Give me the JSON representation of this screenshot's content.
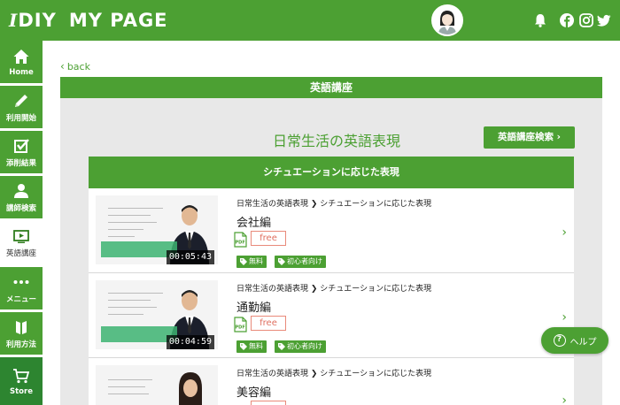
{
  "header": {
    "logo_mark": "I",
    "logo_text": "DIY",
    "logo_page": "MY PAGE",
    "icons": [
      "avatar",
      "bell-icon",
      "facebook-icon",
      "instagram-icon",
      "twitter-icon"
    ]
  },
  "sidebar": {
    "items": [
      {
        "label": "Home",
        "icon": "home-icon"
      },
      {
        "label": "利用開始",
        "icon": "pencil-icon"
      },
      {
        "label": "添削結果",
        "icon": "checkbox-icon"
      },
      {
        "label": "講師検索",
        "icon": "person-icon"
      },
      {
        "label": "英語講座",
        "icon": "video-icon"
      },
      {
        "label": "メニュー",
        "icon": "dots-icon"
      },
      {
        "label": "利用方法",
        "icon": "book-icon"
      },
      {
        "label": "Store",
        "icon": "cart-icon"
      }
    ]
  },
  "main": {
    "back_label": "back",
    "panel_title": "英語講座",
    "course_title": "日常生活の英語表現",
    "search_button": "英語講座検索",
    "section_title": "シチュエーションに応じた表現"
  },
  "lessons": [
    {
      "crumb_parent": "日常生活の英語表現",
      "crumb_child": "シチュエーションに応じた表現",
      "title": "会社編",
      "badge": "free",
      "duration": "00:05:43",
      "tags": [
        "無料",
        "初心者向け"
      ]
    },
    {
      "crumb_parent": "日常生活の英語表現",
      "crumb_child": "シチュエーションに応じた表現",
      "title": "通勤編",
      "badge": "free",
      "duration": "00:04:59",
      "tags": [
        "無料",
        "初心者向け"
      ]
    },
    {
      "crumb_parent": "日常生活の英語表現",
      "crumb_child": "シチュエーションに応じた表現",
      "title": "美容編",
      "badge": "free",
      "duration": "",
      "tags": []
    }
  ],
  "help": {
    "label": "ヘルプ"
  },
  "colors": {
    "brand_green": "#4ca033",
    "store_green": "#2d8530",
    "free_badge": "#e07060"
  }
}
